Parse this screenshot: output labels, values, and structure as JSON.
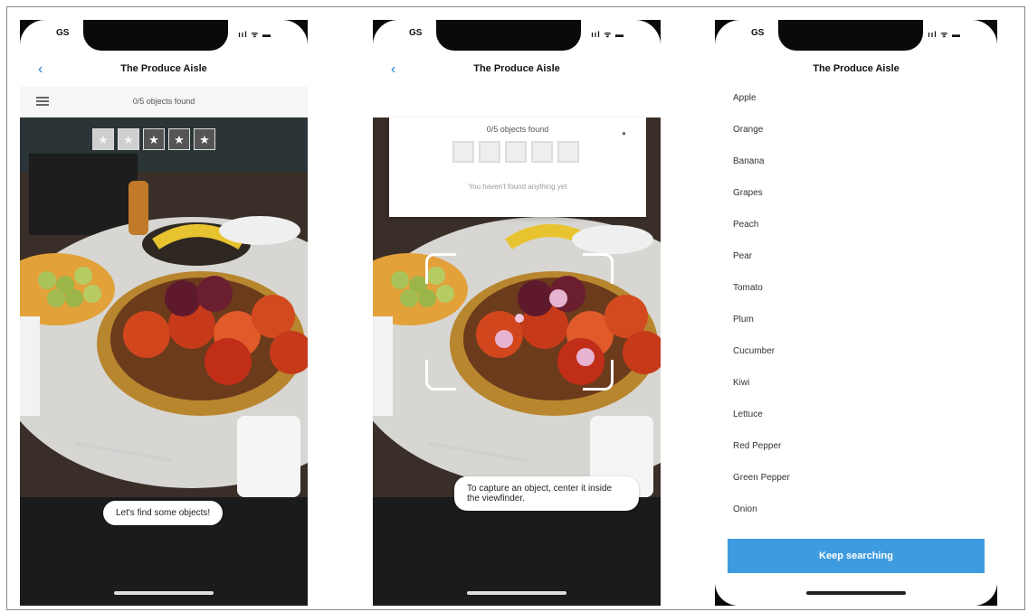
{
  "status": {
    "time": "GS",
    "icons": "ııl ᯤ ▬"
  },
  "screen1": {
    "title": "The Produce Aisle",
    "back_icon": "chevron-left-icon",
    "count_text": "0/5 objects found",
    "stars_total": 5,
    "stars_faded": 2,
    "toast": "Let's find some objects!"
  },
  "screen2": {
    "title": "The Produce Aisle",
    "back_icon": "chevron-left-icon",
    "count_text": "0/5 objects found",
    "empty_message": "You haven't found anything yet",
    "toast": "To capture an object, center it inside the viewfinder."
  },
  "screen3": {
    "title": "The Produce Aisle",
    "items": [
      "Apple",
      "Orange",
      "Banana",
      "Grapes",
      "Peach",
      "Pear",
      "Tomato",
      "Plum",
      "Cucumber",
      "Kiwi",
      "Lettuce",
      "Red Pepper",
      "Green Pepper",
      "Onion"
    ],
    "button_label": "Keep searching",
    "accent": "#3f9be0"
  }
}
